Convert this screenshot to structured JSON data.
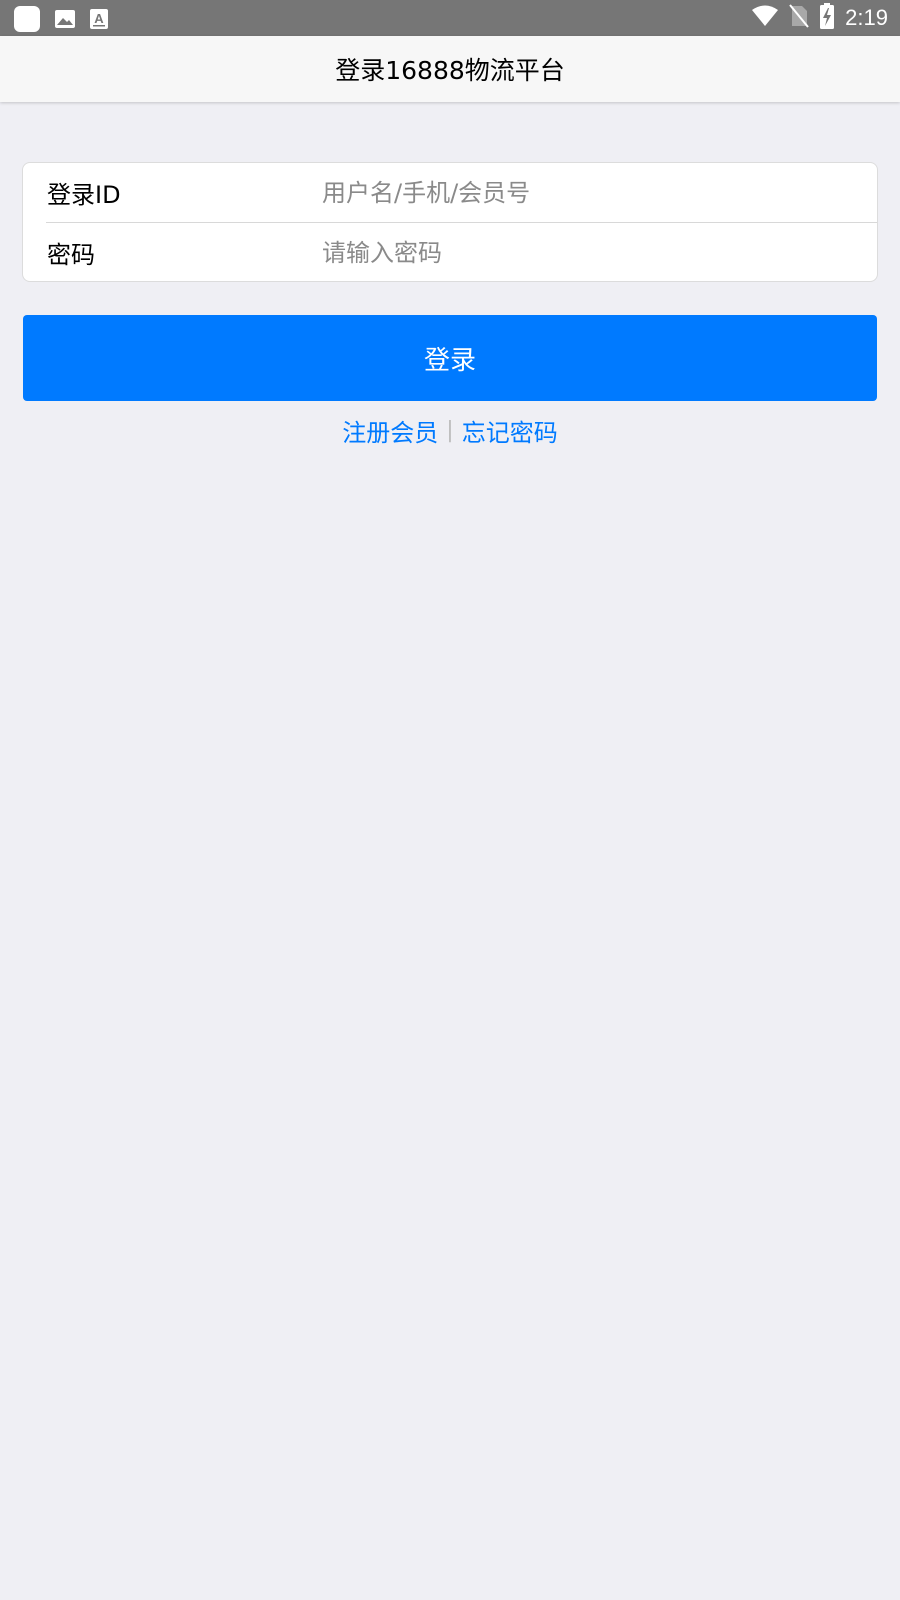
{
  "status_bar": {
    "time": "2:19",
    "left_icons": [
      "app-square-icon",
      "image-icon",
      "text-a-icon"
    ],
    "right_icons": [
      "wifi-icon",
      "no-sim-icon",
      "battery-charging-icon"
    ]
  },
  "nav": {
    "title": "登录16888物流平台"
  },
  "form": {
    "login_id_label": "登录ID",
    "login_id_placeholder": "用户名/手机/会员号",
    "password_label": "密码",
    "password_placeholder": "请输入密码"
  },
  "actions": {
    "login_label": "登录",
    "register_label": "注册会员",
    "separator": "|",
    "forgot_label": "忘记密码"
  },
  "colors": {
    "primary": "#007aff",
    "background": "#efeff4",
    "status_bar": "#767676"
  }
}
